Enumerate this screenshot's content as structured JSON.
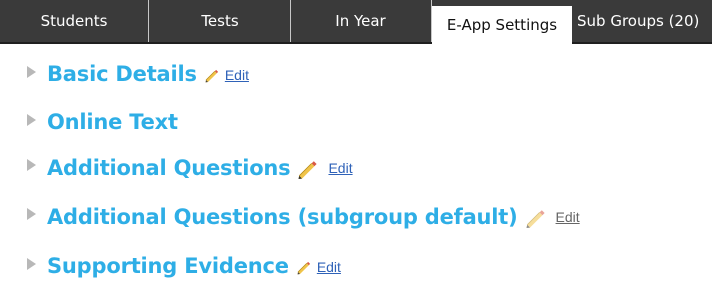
{
  "tabs": {
    "students": "Students",
    "tests": "Tests",
    "in_year": "In Year",
    "eapp_settings": "E-App Settings",
    "sub_groups": "Sub Groups (20)"
  },
  "sections": {
    "basic_details": {
      "title": "Basic Details",
      "edit_label": "Edit",
      "icon": "pencil-icon"
    },
    "online_text": {
      "title": "Online Text"
    },
    "additional_questions": {
      "title": "Additional Questions",
      "edit_label": "Edit",
      "icon": "pencil-icon"
    },
    "additional_questions_subgroup_default": {
      "title": "Additional Questions (subgroup default)",
      "edit_label": "Edit",
      "icon": "pencil-icon"
    },
    "supporting_evidence": {
      "title": "Supporting Evidence",
      "edit_label": "Edit",
      "icon": "pencil-icon"
    }
  },
  "colors": {
    "tab_bar": "#3a3a3a",
    "active_tab_bg": "#ffffff",
    "section_title": "#2eaee6",
    "edit_link": "#2f62b8",
    "muted_edit_link": "#666666"
  }
}
